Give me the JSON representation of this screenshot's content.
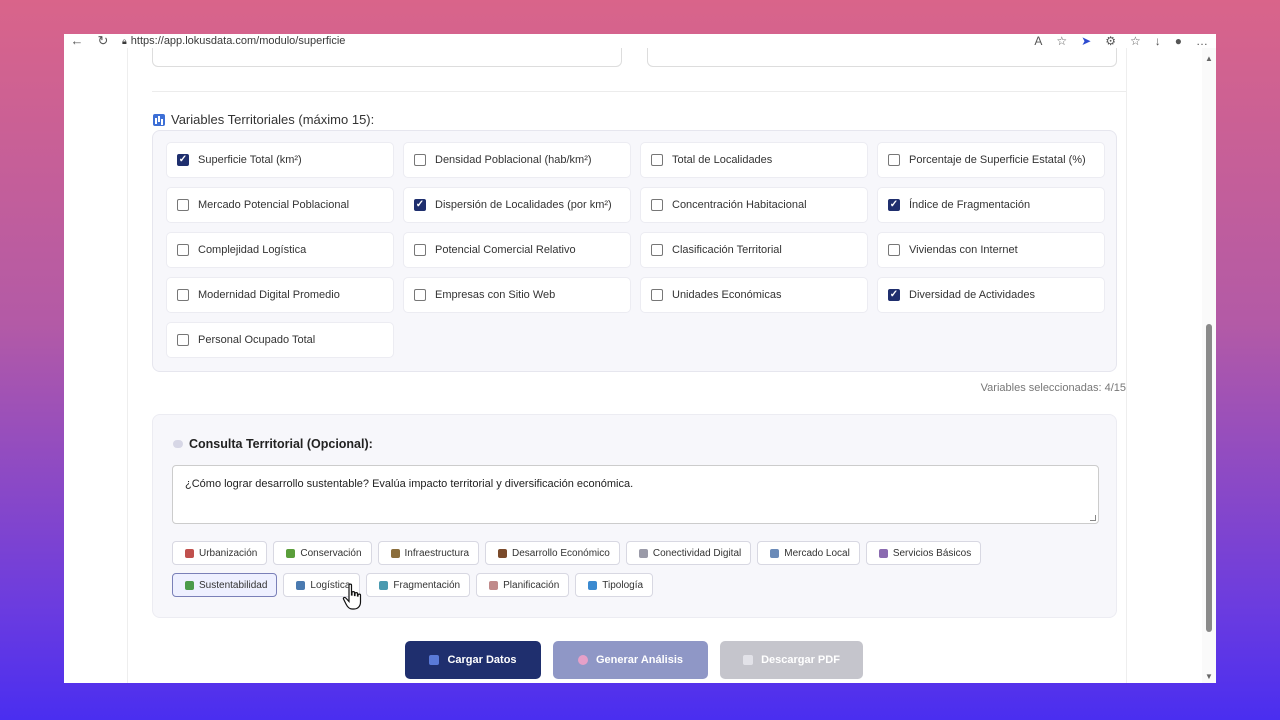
{
  "browser": {
    "url": "https://app.lokusdata.com/modulo/superficie",
    "nav_icons": [
      "back-icon",
      "refresh-icon"
    ],
    "toolbar_icons": [
      "read-aloud-icon",
      "favorite-icon",
      "copilot-icon",
      "extensions-icon",
      "favorites-bar-icon",
      "download-icon",
      "profile-icon",
      "more-icon"
    ]
  },
  "variables": {
    "title": "Variables Territoriales (máximo 15):",
    "items": [
      {
        "label": "Superficie Total (km²)",
        "checked": true
      },
      {
        "label": "Densidad Poblacional (hab/km²)",
        "checked": false
      },
      {
        "label": "Total de Localidades",
        "checked": false
      },
      {
        "label": "Porcentaje de Superficie Estatal (%)",
        "checked": false
      },
      {
        "label": "Mercado Potencial Poblacional",
        "checked": false
      },
      {
        "label": "Dispersión de Localidades (por km²)",
        "checked": true
      },
      {
        "label": "Concentración Habitacional",
        "checked": false
      },
      {
        "label": "Índice de Fragmentación",
        "checked": true
      },
      {
        "label": "Complejidad Logística",
        "checked": false
      },
      {
        "label": "Potencial Comercial Relativo",
        "checked": false
      },
      {
        "label": "Clasificación Territorial",
        "checked": false
      },
      {
        "label": "Viviendas con Internet",
        "checked": false
      },
      {
        "label": "Modernidad Digital Promedio",
        "checked": false
      },
      {
        "label": "Empresas con Sitio Web",
        "checked": false
      },
      {
        "label": "Unidades Económicas",
        "checked": false
      },
      {
        "label": "Diversidad de Actividades",
        "checked": true
      },
      {
        "label": "Personal Ocupado Total",
        "checked": false
      }
    ],
    "selected_text": "Variables seleccionadas: 4/15"
  },
  "consulta": {
    "title": "Consulta Territorial (Opcional):",
    "query": "¿Cómo lograr desarrollo sustentable? Evalúa impacto territorial y diversificación económica.",
    "chips_row1": [
      {
        "label": "Urbanización",
        "color": "#c0504d"
      },
      {
        "label": "Conservación",
        "color": "#5a9e3a"
      },
      {
        "label": "Infraestructura",
        "color": "#8a6d3b"
      },
      {
        "label": "Desarrollo Económico",
        "color": "#7a4a2a"
      },
      {
        "label": "Conectividad Digital",
        "color": "#9a9aa8"
      },
      {
        "label": "Mercado Local",
        "color": "#6a8ab8"
      },
      {
        "label": "Servicios Básicos",
        "color": "#8a6ab0"
      }
    ],
    "chips_row2": [
      {
        "label": "Sustentabilidad",
        "color": "#4a9a4a",
        "active": true
      },
      {
        "label": "Logística",
        "color": "#4a7ab0"
      },
      {
        "label": "Fragmentación",
        "color": "#4a9ab0"
      },
      {
        "label": "Planificación",
        "color": "#c08a8a"
      },
      {
        "label": "Tipología",
        "color": "#3a8ad0"
      }
    ]
  },
  "actions": {
    "load": "Cargar Datos",
    "analyze": "Generar Análisis",
    "pdf": "Descargar PDF"
  }
}
